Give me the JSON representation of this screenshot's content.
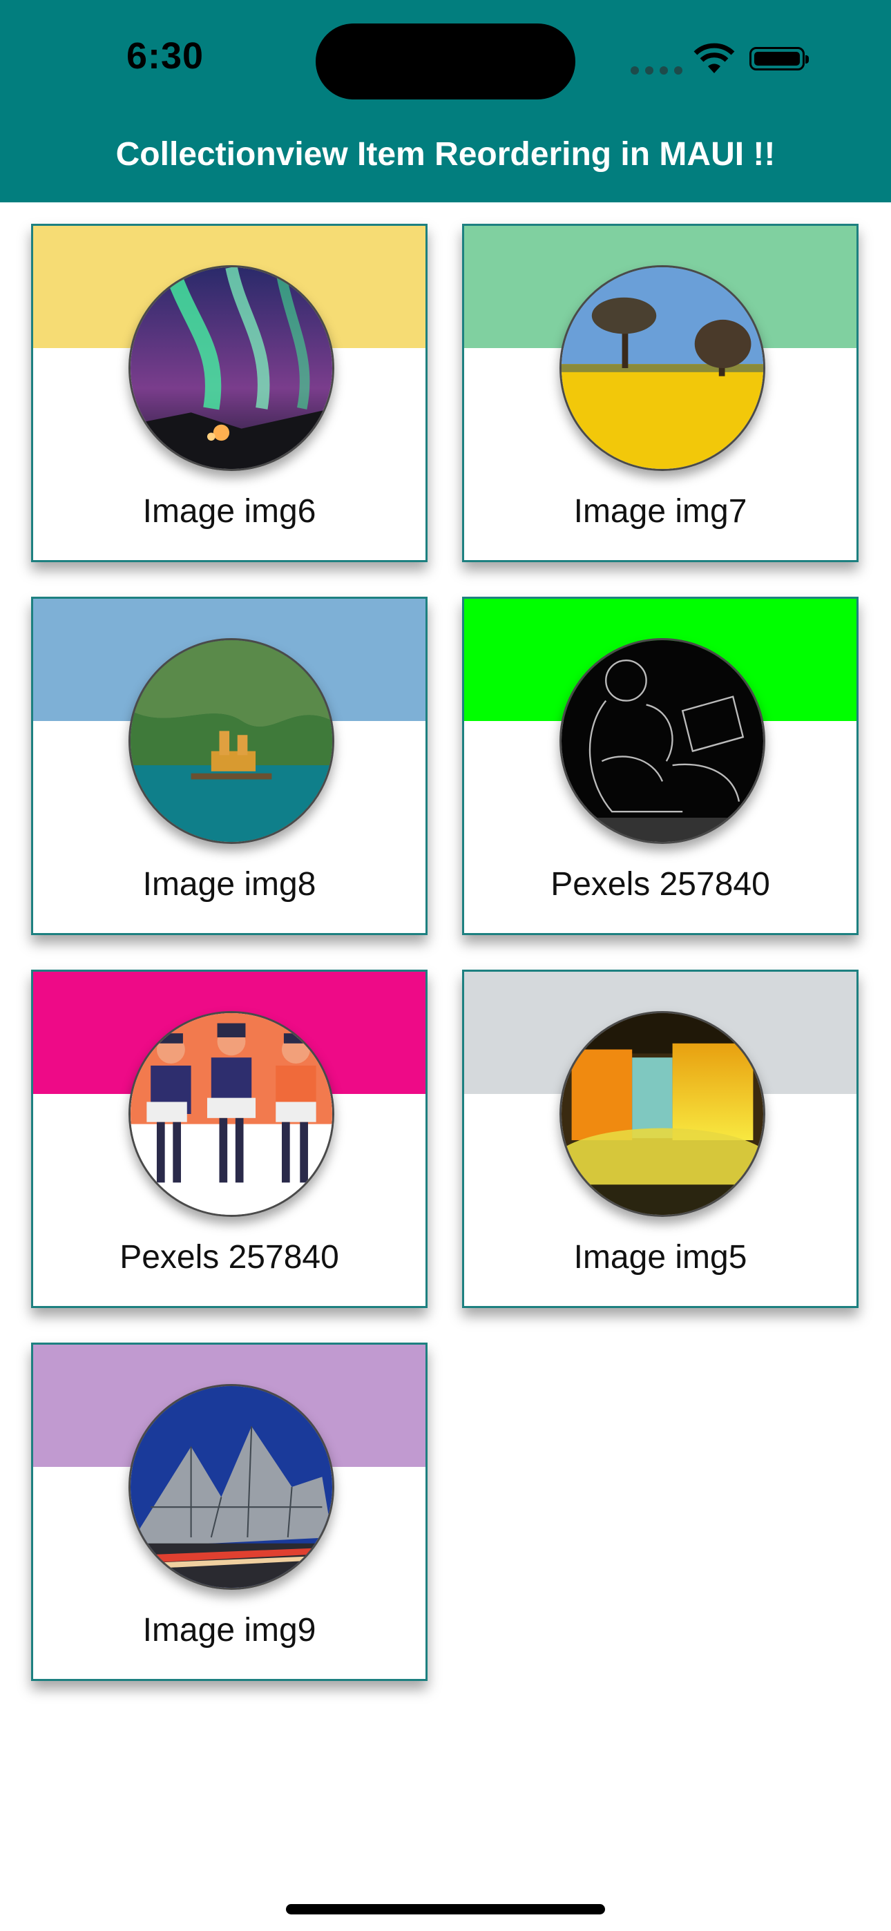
{
  "status_bar": {
    "time": "6:30"
  },
  "header": {
    "title": "Collectionview Item Reordering in MAUI !!"
  },
  "items": [
    {
      "label": "Image img6",
      "band_color": "#f6dc74",
      "image": "aurora"
    },
    {
      "label": "Image img7",
      "band_color": "#80d0a0",
      "image": "yellow-field-trees"
    },
    {
      "label": "Image img8",
      "band_color": "#7eb0d6",
      "image": "karst-bay-boat"
    },
    {
      "label": "Pexels 257840",
      "band_color": "#00ff00",
      "image": "line-art-laptop-person"
    },
    {
      "label": "Pexels 257840",
      "band_color": "#ee0a87",
      "image": "people-with-laptops"
    },
    {
      "label": "Image img5",
      "band_color": "#d5d9dc",
      "image": "golden-waterfall"
    },
    {
      "label": "Image img9",
      "band_color": "#c19ad0",
      "image": "crystal-building-night"
    }
  ]
}
